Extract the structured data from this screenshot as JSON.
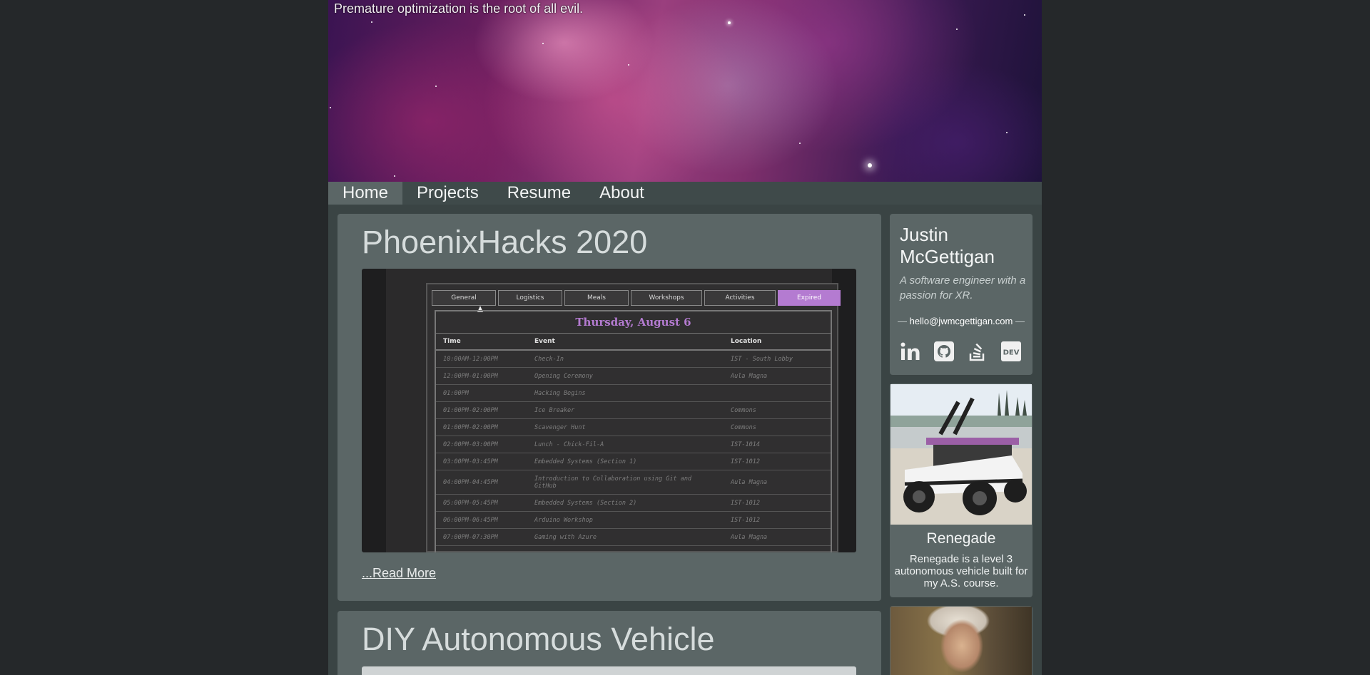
{
  "banner": {
    "tagline": "Premature optimization is the root of all evil."
  },
  "nav": {
    "items": [
      {
        "label": "Home",
        "active": true
      },
      {
        "label": "Projects",
        "active": false
      },
      {
        "label": "Resume",
        "active": false
      },
      {
        "label": "About",
        "active": false
      }
    ]
  },
  "posts": [
    {
      "title": "PhoenixHacks 2020",
      "read_more": "...Read More",
      "screenshot": {
        "tabs": [
          "General",
          "Logistics",
          "Meals",
          "Workshops",
          "Activities",
          "Expired"
        ],
        "active_tab": "Expired",
        "date": "Thursday, August 6",
        "headers": [
          "Time",
          "Event",
          "Location"
        ],
        "rows": [
          [
            "10:00AM-12:00PM",
            "Check-In",
            "IST - South Lobby"
          ],
          [
            "12:00PM-01:00PM",
            "Opening Ceremony",
            "Aula Magna"
          ],
          [
            "01:00PM",
            "Hacking Begins",
            ""
          ],
          [
            "01:00PM-02:00PM",
            "Ice Breaker",
            "Commons"
          ],
          [
            "01:00PM-02:00PM",
            "Scavenger Hunt",
            "Commons"
          ],
          [
            "02:00PM-03:00PM",
            "Lunch - Chick-Fil-A",
            "IST-1014"
          ],
          [
            "03:00PM-03:45PM",
            "Embedded Systems (Section 1)",
            "IST-1012"
          ],
          [
            "04:00PM-04:45PM",
            "Introduction to Collaboration using Git and GitHub",
            "Aula Magna"
          ],
          [
            "05:00PM-05:45PM",
            "Embedded Systems (Section 2)",
            "IST-1012"
          ],
          [
            "06:00PM-06:45PM",
            "Arduino Workshop",
            "IST-1012"
          ],
          [
            "07:00PM-07:30PM",
            "Gaming with Azure",
            "Aula Magna"
          ]
        ]
      }
    },
    {
      "title": "DIY Autonomous Vehicle"
    }
  ],
  "profile": {
    "name": "Justin McGettigan",
    "bio": "A software engineer with a passion for XR.",
    "email": "hello@jwmcgettigan.com",
    "dash": "—",
    "socials": [
      "linkedin-icon",
      "github-icon",
      "stackoverflow-icon",
      "dev-icon"
    ],
    "dev_label": "DEV"
  },
  "projects": [
    {
      "title": "Renegade",
      "description": "Renegade is a level 3 autonomous vehicle built for my A.S. course."
    }
  ]
}
